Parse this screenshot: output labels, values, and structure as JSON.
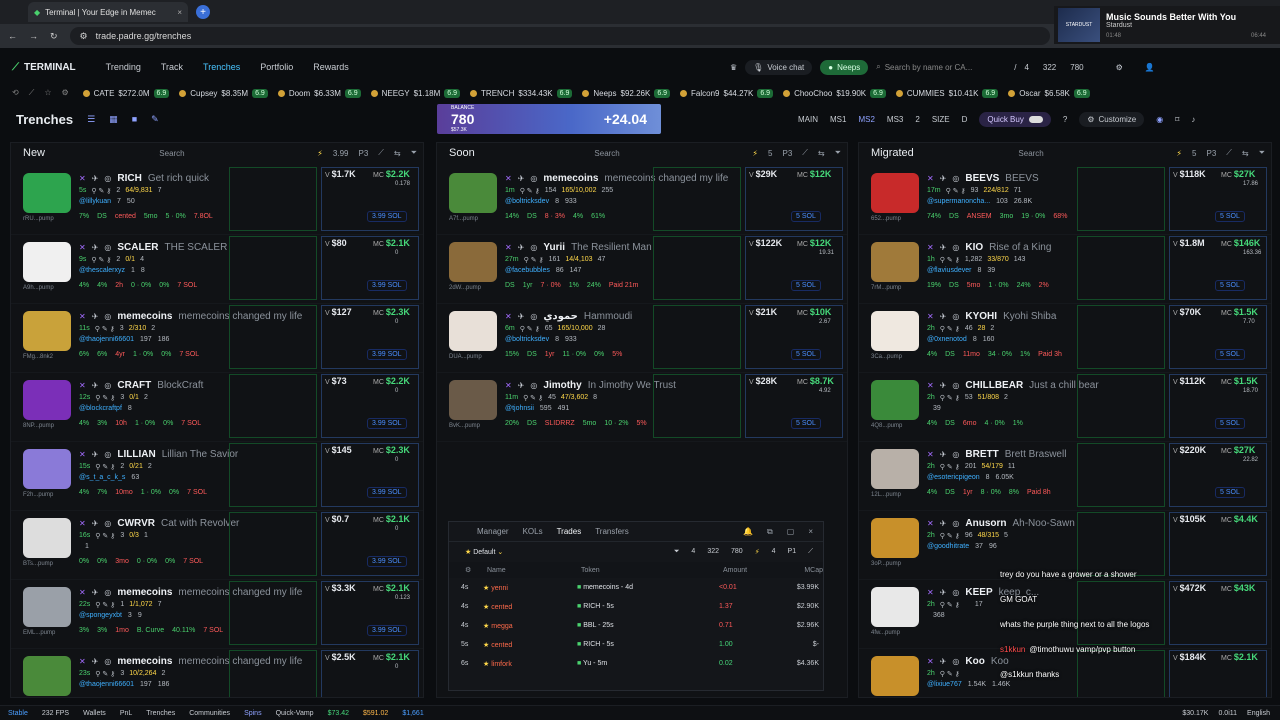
{
  "browser": {
    "tab_title": "Terminal | Your Edge in Memec",
    "url": "trade.padre.gg/trenches"
  },
  "media": {
    "art_label": "STARDUST",
    "title": "Music Sounds Better With You",
    "artist": "Stardust",
    "time_now": "01:48",
    "time_total": "06:44"
  },
  "nav": {
    "brand": "TERMINAL",
    "links": [
      "Trending",
      "Track",
      "Trenches",
      "Portfolio",
      "Rewards"
    ],
    "voice": "Voice chat",
    "neeps": "Neeps",
    "search_placeholder": "Search by name or CA...",
    "slash": "/",
    "stats": [
      "4",
      "322",
      "780"
    ]
  },
  "ticker": [
    {
      "sym": "CATE",
      "val": "$272.0M",
      "chg": "6.9"
    },
    {
      "sym": "Cupsey",
      "val": "$8.35M",
      "chg": "6.9"
    },
    {
      "sym": "Doom",
      "val": "$6.33M",
      "chg": "6.9"
    },
    {
      "sym": "NEEGY",
      "val": "$1.18M",
      "chg": "6.9"
    },
    {
      "sym": "TRENCH",
      "val": "$334.43K",
      "chg": "6.9"
    },
    {
      "sym": "Neeps",
      "val": "$92.26K",
      "chg": "6.9"
    },
    {
      "sym": "Falcon9",
      "val": "$44.27K",
      "chg": "6.9"
    },
    {
      "sym": "ChooChoo",
      "val": "$19.90K",
      "chg": "6.9"
    },
    {
      "sym": "CUMMIES",
      "val": "$10.41K",
      "chg": "6.9"
    },
    {
      "sym": "Oscar",
      "val": "$6.58K",
      "chg": "6.9"
    }
  ],
  "trenchbar": {
    "title": "Trenches",
    "balance_label": "BALANCE",
    "balance_sub": "$57.3K",
    "banner_left": "780",
    "banner_right": "+24.04",
    "modes": [
      "MAIN",
      "MS1",
      "MS2",
      "MS3",
      "2",
      "SIZE",
      "D"
    ],
    "quick_buy": "Quick Buy",
    "customize": "Customize"
  },
  "columns": [
    {
      "title": "New",
      "search": "Search",
      "amount": "3.99",
      "preset": "P3",
      "cards": [
        {
          "sym": "RICH",
          "name": "Get rich quick",
          "age": "5s",
          "handle": "@lillykuan",
          "holders": "7",
          "snipe": "50",
          "dom": "rRU...pump",
          "txs": "2",
          "buy": "64/9,831",
          "sell": "7",
          "vol": "$1.7K",
          "mc": "$2.2K",
          "f": "0.178",
          "sol": "3.99 SOL",
          "pcts": [
            "7%",
            "DS",
            "cented",
            "5mo",
            "5 · 0%",
            "7.8OL"
          ],
          "color": "#2da44e"
        },
        {
          "sym": "SCALER",
          "name": "THE SCALER",
          "age": "9s",
          "handle": "@thescalerxyz",
          "holders": "1",
          "snipe": "8",
          "dom": "A9h...pump",
          "txs": "2",
          "buy": "0/1",
          "sell": "4",
          "vol": "$80",
          "mc": "$2.1K",
          "f": "0",
          "sol": "3.99 SOL",
          "pcts": [
            "4%",
            "4%",
            "2h",
            "0 · 0%",
            "0%",
            "7 SOL"
          ],
          "color": "#f0f0f0"
        },
        {
          "sym": "memecoins",
          "name": "memecoins changed my life",
          "age": "11s",
          "handle": "@thaojenni66601",
          "holders": "197",
          "snipe": "186",
          "dom": "FMg...8nk2",
          "txs": "3",
          "buy": "2/310",
          "sell": "2",
          "vol": "$127",
          "mc": "$2.3K",
          "f": "0",
          "sol": "3.99 SOL",
          "pcts": [
            "6%",
            "6%",
            "4yr",
            "1 · 0%",
            "0%",
            "7 SOL"
          ],
          "color": "#c9a23a"
        },
        {
          "sym": "CRAFT",
          "name": "BlockCraft",
          "age": "12s",
          "handle": "@blockcraftpf",
          "holders": "8",
          "snipe": "",
          "dom": "8NP...pump",
          "txs": "3",
          "buy": "0/1",
          "sell": "2",
          "vol": "$73",
          "mc": "$2.2K",
          "f": "0",
          "sol": "3.99 SOL",
          "pcts": [
            "4%",
            "3%",
            "10h",
            "1 · 0%",
            "0%",
            "7 SOL"
          ],
          "color": "#7b2fb8"
        },
        {
          "sym": "LILLIAN",
          "name": "Lillian The Savior",
          "age": "15s",
          "handle": "@s_t_a_c_k_s",
          "holders": "63",
          "snipe": "",
          "dom": "F2h...pump",
          "txs": "2",
          "buy": "0/21",
          "sell": "2",
          "vol": "$145",
          "mc": "$2.3K",
          "f": "0",
          "sol": "3.99 SOL",
          "pcts": [
            "4%",
            "7%",
            "10mo",
            "1 · 0%",
            "0%",
            "7 SOL"
          ],
          "color": "#8a7ad8"
        },
        {
          "sym": "CWRVR",
          "name": "Cat with Revolver",
          "age": "16s",
          "handle": "",
          "holders": "1",
          "snipe": "",
          "dom": "BTs...pump",
          "txs": "3",
          "buy": "0/3",
          "sell": "1",
          "vol": "$0.7",
          "mc": "$2.1K",
          "f": "0",
          "sol": "3.99 SOL",
          "pcts": [
            "0%",
            "0%",
            "3mo",
            "0 · 0%",
            "0%",
            "7 SOL"
          ],
          "color": "#dddddd"
        },
        {
          "sym": "memecoins",
          "name": "memecoins changed my life",
          "age": "22s",
          "handle": "@spongeyxbt",
          "holders": "3",
          "snipe": "9",
          "dom": "EML...pump",
          "txs": "1",
          "buy": "1/1,072",
          "sell": "7",
          "vol": "$3.3K",
          "mc": "$2.1K",
          "f": "0.123",
          "sol": "3.99 SOL",
          "pcts": [
            "3%",
            "3%",
            "1mo",
            "B. Curve",
            "40.11%",
            "7 SOL"
          ],
          "color": "#9aa0a8"
        },
        {
          "sym": "memecoins",
          "name": "memecoins changed my life",
          "age": "23s",
          "handle": "@thaojenni66601",
          "holders": "197",
          "snipe": "186",
          "dom": "",
          "txs": "3",
          "buy": "10/2,264",
          "sell": "2",
          "vol": "$2.5K",
          "mc": "$2.1K",
          "f": "0",
          "sol": "",
          "pcts": [
            "",
            "",
            "",
            "",
            "",
            ""
          ],
          "color": "#4a8a3a"
        }
      ]
    },
    {
      "title": "Soon",
      "search": "Search",
      "amount": "5",
      "preset": "P3",
      "cards": [
        {
          "sym": "memecoins",
          "name": "memecoins changed my life",
          "age": "1m",
          "handle": "@boltricksdev",
          "holders": "8",
          "snipe": "933",
          "dom": "A7f...pump",
          "txs": "154",
          "buy": "165/10,002",
          "sell": "255",
          "vol": "$29K",
          "mc": "$12K",
          "f": "",
          "sol": "5 SOL",
          "pcts": [
            "14%",
            "DS",
            "8 · 3%",
            "4%",
            "61%",
            ""
          ],
          "color": "#4a8a3a"
        },
        {
          "sym": "Yurii",
          "name": "The Resilient Man",
          "age": "27m",
          "handle": "@facebubbles",
          "holders": "86",
          "snipe": "147",
          "dom": "2dW...pump",
          "txs": "161",
          "buy": "14/4,103",
          "sell": "47",
          "vol": "$122K",
          "mc": "$12K",
          "f": "19.31",
          "sol": "5 SOL",
          "pcts": [
            "DS",
            "1yr",
            "7 · 0%",
            "1%",
            "24%",
            "Paid 21m"
          ],
          "color": "#8a6a3a"
        },
        {
          "sym": "حمودي",
          "name": "Hammoudi",
          "age": "6m",
          "handle": "@boltricksdev",
          "holders": "8",
          "snipe": "933",
          "dom": "DUA...pump",
          "txs": "65",
          "buy": "165/10,000",
          "sell": "28",
          "vol": "$21K",
          "mc": "$10K",
          "f": "2.67",
          "sol": "5 SOL",
          "pcts": [
            "15%",
            "DS",
            "1yr",
            "11 · 0%",
            "0%",
            "5%"
          ],
          "color": "#e8e0d8"
        },
        {
          "sym": "Jimothy",
          "name": "In Jimothy We Trust",
          "age": "11m",
          "handle": "@tjohnsii",
          "holders": "595",
          "snipe": "491",
          "dom": "BvK...pump",
          "txs": "45",
          "buy": "47/3,602",
          "sell": "8",
          "vol": "$28K",
          "mc": "$8.7K",
          "f": "4.92",
          "sol": "5 SOL",
          "pcts": [
            "20%",
            "DS",
            "SLIDRRZ",
            "5mo",
            "10 · 2%",
            "5%"
          ],
          "color": "#6a5a48"
        }
      ]
    },
    {
      "title": "Migrated",
      "search": "Search",
      "amount": "5",
      "preset": "P3",
      "cards": [
        {
          "sym": "BEEVS",
          "name": "BEEVS",
          "age": "17m",
          "handle": "@supermanoncha...",
          "holders": "103",
          "snipe": "26.8K",
          "dom": "652...pump",
          "txs": "93",
          "buy": "224/812",
          "sell": "71",
          "vol": "$118K",
          "mc": "$27K",
          "f": "17.86",
          "sol": "5 SOL",
          "pcts": [
            "74%",
            "DS",
            "ANSEM",
            "3mo",
            "19 · 0%",
            "68%"
          ],
          "color": "#c82a2a"
        },
        {
          "sym": "KIO",
          "name": "Rise of a King",
          "age": "1h",
          "handle": "@flaviusdever",
          "holders": "8",
          "snipe": "39",
          "dom": "7rM...pump",
          "txs": "1,282",
          "buy": "33/870",
          "sell": "143",
          "vol": "$1.8M",
          "mc": "$146K",
          "f": "163.36",
          "sol": "5 SOL",
          "pcts": [
            "19%",
            "DS",
            "5mo",
            "1 · 0%",
            "24%",
            "2%"
          ],
          "color": "#a07a3a"
        },
        {
          "sym": "KYOHI",
          "name": "Kyohi Shiba",
          "age": "2h",
          "handle": "@0xnenotod",
          "holders": "8",
          "snipe": "160",
          "dom": "3Ca...pump",
          "txs": "46",
          "buy": "28",
          "sell": "2",
          "vol": "$70K",
          "mc": "$1.5K",
          "f": "7.70",
          "sol": "5 SOL",
          "pcts": [
            "4%",
            "DS",
            "11mo",
            "34 · 0%",
            "1%",
            "Paid 3h"
          ],
          "color": "#efe8e0"
        },
        {
          "sym": "CHILLBEAR",
          "name": "Just a chill bear",
          "age": "2h",
          "handle": "",
          "holders": "39",
          "snipe": "",
          "dom": "4Q8...pump",
          "txs": "53",
          "buy": "51/808",
          "sell": "2",
          "vol": "$112K",
          "mc": "$1.5K",
          "f": "18.70",
          "sol": "5 SOL",
          "pcts": [
            "4%",
            "DS",
            "6mo",
            "4 · 0%",
            "1%",
            ""
          ],
          "color": "#3a8a3a"
        },
        {
          "sym": "BRETT",
          "name": "Brett Braswell",
          "age": "2h",
          "handle": "@esotericpigeon",
          "holders": "8",
          "snipe": "6.05K",
          "dom": "12L...pump",
          "txs": "201",
          "buy": "54/179",
          "sell": "11",
          "vol": "$220K",
          "mc": "$27K",
          "f": "22.82",
          "sol": "5 SOL",
          "pcts": [
            "4%",
            "DS",
            "1yr",
            "8 · 0%",
            "8%",
            "Paid 8h"
          ],
          "color": "#b8b0a8"
        },
        {
          "sym": "Anusorn",
          "name": "Ah-Noo-Sawn",
          "age": "2h",
          "handle": "@goodhitrate",
          "holders": "37",
          "snipe": "96",
          "dom": "3oP...pump",
          "txs": "96",
          "buy": "48/315",
          "sell": "5",
          "vol": "$105K",
          "mc": "$4.4K",
          "f": "",
          "sol": "",
          "pcts": [
            "",
            "",
            "",
            "",
            "",
            ""
          ],
          "color": "#c8902a"
        },
        {
          "sym": "KEEP",
          "name": "keep_c...",
          "age": "2h",
          "handle": "",
          "holders": "368",
          "snipe": "",
          "dom": "4fw...pump",
          "txs": "",
          "buy": "",
          "sell": "17",
          "vol": "$472K",
          "mc": "$43K",
          "f": "",
          "sol": "",
          "pcts": [
            "",
            "",
            "",
            "",
            "",
            ""
          ],
          "color": "#e8e8e8"
        },
        {
          "sym": "Koo",
          "name": "Koo",
          "age": "2h",
          "handle": "@lixiue767",
          "holders": "1.54K",
          "snipe": "1.46K",
          "dom": "",
          "txs": "",
          "buy": "",
          "sell": "",
          "vol": "$184K",
          "mc": "$2.1K",
          "f": "",
          "sol": "",
          "pcts": [
            "",
            "",
            "",
            "",
            "",
            ""
          ],
          "color": "#c8902a"
        }
      ]
    }
  ],
  "manager": {
    "tabs": [
      "Manager",
      "KOLs",
      "Trades",
      "Transfers"
    ],
    "filter": "Default",
    "stats": [
      "4",
      "322",
      "780",
      "4",
      "P1"
    ],
    "headers": [
      "Name",
      "Token",
      "Amount",
      "MCap"
    ],
    "rows": [
      {
        "age": "4s",
        "name": "yenni",
        "token": "memecoins - 4d",
        "amount": "<0.01",
        "mc": "$3.99K",
        "neg": true
      },
      {
        "age": "4s",
        "name": "cented",
        "token": "RICH - 5s",
        "amount": "1.37",
        "mc": "$2.90K",
        "neg": true
      },
      {
        "age": "4s",
        "name": "megga",
        "token": "BBL - 25s",
        "amount": "0.71",
        "mc": "$2.96K",
        "neg": true
      },
      {
        "age": "5s",
        "name": "cented",
        "token": "RICH - 5s",
        "amount": "1.00",
        "mc": "$-",
        "neg": false
      },
      {
        "age": "6s",
        "name": "limfork",
        "token": "Yu - 5m",
        "amount": "0.02",
        "mc": "$4.36K",
        "neg": false
      }
    ]
  },
  "chat": [
    {
      "u": "",
      "m": "trey do you have a grower or a shower"
    },
    {
      "u": "",
      "m": "GM GOAT"
    },
    {
      "u": "",
      "m": "whats the purple thing next to all the logos"
    },
    {
      "u": "s1kkun",
      "m": "@timothuwu vamp/pvp button"
    },
    {
      "u": "",
      "m": "@s1kkun thanks"
    }
  ],
  "status": {
    "stable": "Stable",
    "fps": "232 FPS",
    "items": [
      "Wallets",
      "PnL",
      "Trenches",
      "Communities",
      "Spins",
      "Quick-Vamp"
    ],
    "prices": [
      "$73.42",
      "$591.02",
      "$1,661"
    ],
    "right": [
      "$30.17K",
      "0.0i11",
      "English"
    ]
  }
}
